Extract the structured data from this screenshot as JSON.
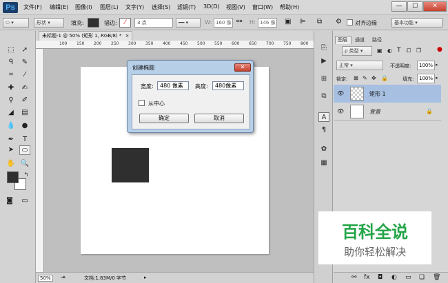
{
  "app": {
    "logo": "Ps"
  },
  "menu": [
    "文件(F)",
    "编辑(E)",
    "图像(I)",
    "图层(L)",
    "文字(Y)",
    "选择(S)",
    "滤镜(T)",
    "3D(D)",
    "视图(V)",
    "窗口(W)",
    "帮助(H)"
  ],
  "window_controls": {
    "minimize": "—",
    "maximize": "☐",
    "close": "✕"
  },
  "options": {
    "shape_mode": "形状",
    "fill_label": "填充:",
    "stroke_label": "描边:",
    "stroke_width": "3 点",
    "w_label": "W:",
    "w_value": "160 像",
    "h_label": "H:",
    "h_value": "146 像",
    "align_edges": "对齐边缘",
    "workspace": "基本功能"
  },
  "document": {
    "tab_title": "未标题-1 @ 50% (矩形 1, RGB/8) *",
    "tab_close": "×"
  },
  "ruler_ticks": [
    "100",
    "150",
    "200",
    "250",
    "300",
    "350",
    "400",
    "450",
    "500",
    "550",
    "600",
    "650",
    "700",
    "750",
    "800"
  ],
  "status": {
    "zoom": "50%",
    "doc_info": "文档:1.83M/0 字节"
  },
  "dialog": {
    "title": "创建椭圆",
    "width_label": "宽度:",
    "width_value": "480 像素",
    "height_label": "高度:",
    "height_value": "480像素",
    "from_center": "从中心",
    "ok": "确定",
    "cancel": "取消"
  },
  "layers_panel": {
    "tabs": [
      "图层",
      "通道",
      "路径"
    ],
    "kind_filter": "ρ 类型",
    "blend_mode": "正常",
    "opacity_label": "不透明度:",
    "opacity_value": "100%",
    "lock_label": "锁定:",
    "fill_label": "填充:",
    "fill_value": "100%",
    "layers": [
      {
        "name": "矩形 1"
      },
      {
        "name": "背景"
      }
    ]
  },
  "watermark": {
    "title": "百科全说",
    "subtitle": "助你轻松解决"
  },
  "colors": {
    "accent_selected": "#a7c0e2",
    "watermark_green": "#24a548"
  }
}
